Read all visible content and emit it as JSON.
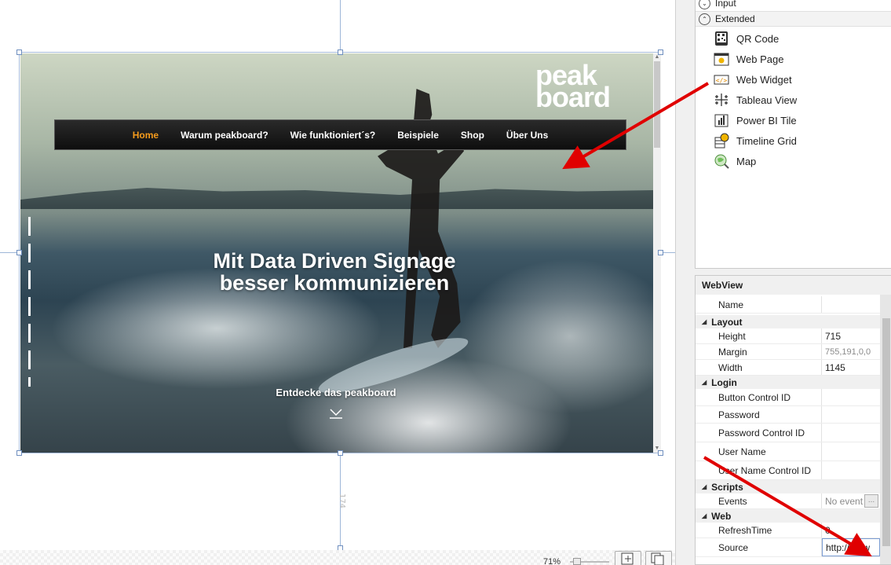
{
  "canvas": {
    "ruler_bottom_value": "174",
    "zoom_label": "71%",
    "zoom_value_percent": 71
  },
  "webpage": {
    "logo_line1": "peak",
    "logo_line2": "board",
    "nav": [
      "Home",
      "Warum peakboard?",
      "Wie funktioniert´s?",
      "Beispiele",
      "Shop",
      "Über Uns"
    ],
    "active_nav": "Home",
    "hero_line1": "Mit Data Driven Signage",
    "hero_line2": "besser kommunizieren",
    "cta": "Entdecke das peakboard"
  },
  "toolbox": {
    "group_input": "Input",
    "group_extended": "Extended",
    "items": [
      {
        "label": "QR Code",
        "icon": "qr-code-icon"
      },
      {
        "label": "Web Page",
        "icon": "web-page-icon"
      },
      {
        "label": "Web Widget",
        "icon": "web-widget-icon"
      },
      {
        "label": "Tableau View",
        "icon": "tableau-icon"
      },
      {
        "label": "Power BI Tile",
        "icon": "power-bi-icon"
      },
      {
        "label": "Timeline Grid",
        "icon": "timeline-grid-icon"
      },
      {
        "label": "Map",
        "icon": "map-icon"
      }
    ]
  },
  "properties": {
    "title": "WebView",
    "name_label": "Name",
    "name_value": "",
    "cat_layout": "Layout",
    "height_label": "Height",
    "height_value": "715",
    "margin_label": "Margin",
    "margin_value": "755,191,0,0",
    "width_label": "Width",
    "width_value": "1145",
    "cat_login": "Login",
    "button_control_label": "Button Control ID",
    "password_label": "Password",
    "password_control_label": "Password Control ID",
    "user_name_label": "User Name",
    "user_name_control_label": "User Name Control ID",
    "cat_scripts": "Scripts",
    "events_label": "Events",
    "events_value": "No event",
    "events_button": "...",
    "cat_web": "Web",
    "refresh_label": "RefreshTime",
    "refresh_value": "0",
    "source_label": "Source",
    "source_value": "http://www"
  },
  "colors": {
    "nav_active": "#f59b1c",
    "arrow": "#e00000"
  }
}
